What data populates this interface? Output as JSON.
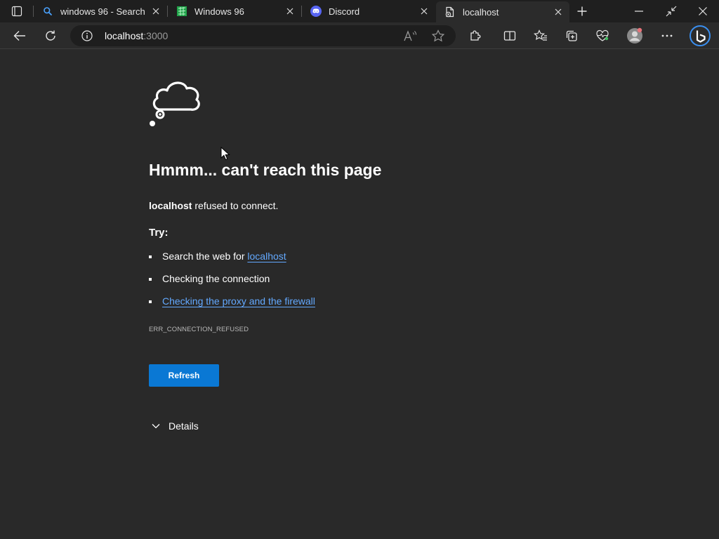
{
  "tabs": [
    {
      "title": "windows 96 - Search",
      "icon": "search-icon"
    },
    {
      "title": "Windows 96",
      "icon": "windows96-favicon"
    },
    {
      "title": "Discord",
      "icon": "discord-icon"
    },
    {
      "title": "localhost",
      "icon": "error-page-icon",
      "active": true
    }
  ],
  "toolbar": {
    "url_host": "localhost",
    "url_port": ":3000"
  },
  "error_page": {
    "headline": "Hmmm... can't reach this page",
    "summary_host": "localhost",
    "summary_text": " refused to connect.",
    "try_label": "Try:",
    "suggestions": [
      {
        "prefix": "Search the web for ",
        "link": "localhost"
      },
      {
        "text": "Checking the connection"
      },
      {
        "link": "Checking the proxy and the firewall"
      }
    ],
    "error_code": "ERR_CONNECTION_REFUSED",
    "refresh_label": "Refresh",
    "details_label": "Details"
  },
  "colors": {
    "page_bg": "#292929",
    "tabstrip_bg": "#1f1f1f",
    "link": "#63a9ff",
    "button_blue": "#0a78d4"
  }
}
